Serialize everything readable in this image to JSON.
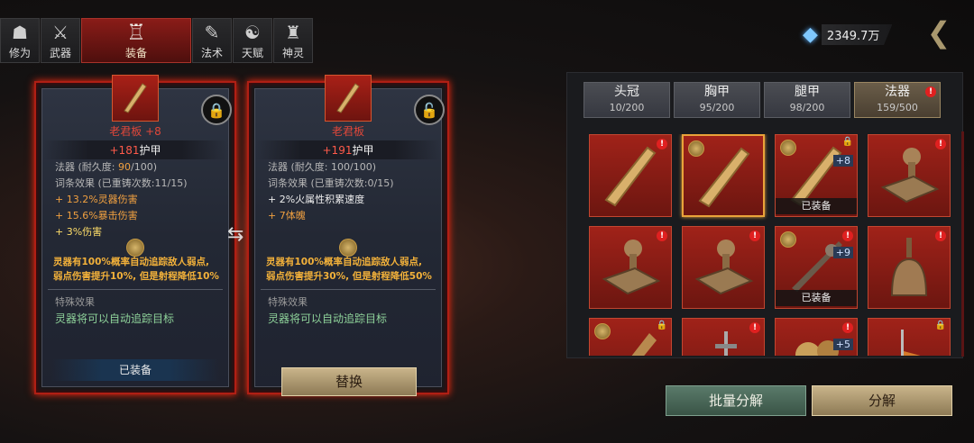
{
  "tabs": [
    {
      "label": "修为",
      "icon": "person-icon"
    },
    {
      "label": "武器",
      "icon": "sword-icon"
    },
    {
      "label": "装备",
      "icon": "robe-icon",
      "active": true
    },
    {
      "label": "法术",
      "icon": "scroll-icon"
    },
    {
      "label": "天赋",
      "icon": "yinyang-icon"
    },
    {
      "label": "神灵",
      "icon": "tablet-icon"
    }
  ],
  "currency": {
    "amount": "2349.7万",
    "icon": "crystal-icon"
  },
  "left_card": {
    "name": "老君板",
    "level": "+8",
    "armor_value": "+181",
    "armor_label": "护甲",
    "durability_prefix": "法器  (耐久度: ",
    "durability_cur": "90",
    "durability_suffix": "/100)",
    "entries_title": "词条效果  (已重铸次数:11/15)",
    "entries": [
      "+ 13.2%灵器伤害",
      "+ 15.6%暴击伤害",
      "+ 3%伤害"
    ],
    "desc_line1": "灵器有100%概率自动追踪敌人弱点,",
    "desc_line2": "弱点伤害提升10%, 但是射程降低10%",
    "special_title": "特殊效果",
    "special": "灵器将可以自动追踪目标",
    "equipped": "已装备"
  },
  "right_card": {
    "name": "老君板",
    "armor_value": "+191",
    "armor_label": "护甲",
    "durability": "法器  (耐久度: 100/100)",
    "entries_title": "词条效果  (已重铸次数:0/15)",
    "entries": [
      "+ 2%火属性积累速度",
      "+ 7体魄"
    ],
    "desc_line1": "灵器有100%概率自动追踪敌人弱点,",
    "desc_line2": "弱点伤害提升30%, 但是射程降低50%",
    "special_title": "特殊效果",
    "special": "灵器将可以自动追踪目标"
  },
  "replace_label": "替换",
  "slot_tabs": [
    {
      "label": "头冠",
      "count": "10/200"
    },
    {
      "label": "胸甲",
      "count": "95/200"
    },
    {
      "label": "腿甲",
      "count": "98/200"
    },
    {
      "label": "法器",
      "count": "159/500",
      "active": true,
      "badge": "!"
    }
  ],
  "items": [
    {
      "type": "board",
      "badge": "!"
    },
    {
      "type": "board",
      "selected": true,
      "coin": true
    },
    {
      "type": "board",
      "coin": true,
      "lock": true,
      "plus": "+8",
      "equipped": "已装备"
    },
    {
      "type": "stamp",
      "badge": "!"
    },
    {
      "type": "stamp",
      "badge": "!"
    },
    {
      "type": "stamp",
      "badge": "!"
    },
    {
      "type": "rod",
      "coin": true,
      "badge": "!",
      "plus": "+9",
      "equipped": "已装备"
    },
    {
      "type": "bell",
      "badge": "!"
    },
    {
      "type": "club",
      "coin": true,
      "lock": true
    },
    {
      "type": "sword",
      "badge": "!"
    },
    {
      "type": "ornament",
      "badge": "!",
      "plus": "+5"
    },
    {
      "type": "flag",
      "lock": true
    }
  ],
  "bulk_label": "批量分解",
  "decompose_label": "分解"
}
